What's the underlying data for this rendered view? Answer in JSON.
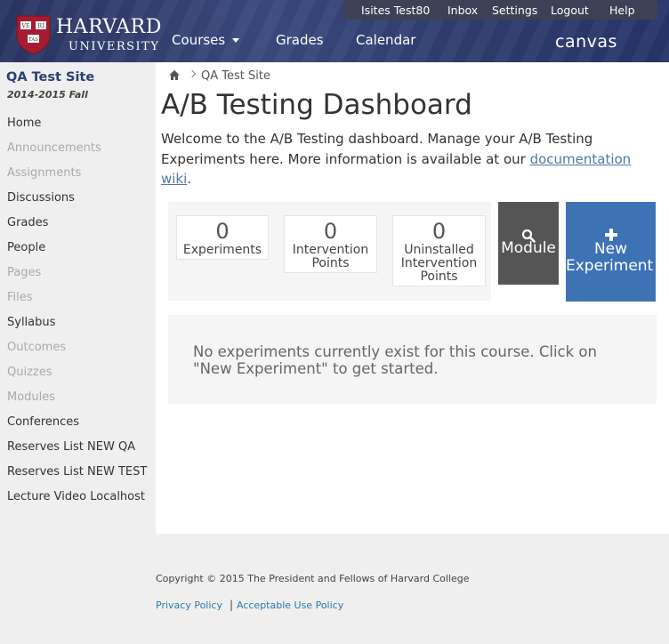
{
  "header": {
    "logo_line1": "HARVARD",
    "logo_line2": "UNIVERSITY",
    "shield_letters": [
      "VE",
      "RI",
      "TAS"
    ],
    "nav": {
      "courses": "Courses",
      "grades": "Grades",
      "calendar": "Calendar"
    },
    "brand": "canvas",
    "user_nav": [
      "Isites Test80",
      "Inbox",
      "Settings",
      "Logout",
      "Help"
    ]
  },
  "sidebar": {
    "course_title": "QA Test Site",
    "term": "2014-2015 Fall",
    "items": [
      {
        "label": "Home",
        "enabled": true
      },
      {
        "label": "Announcements",
        "enabled": false
      },
      {
        "label": "Assignments",
        "enabled": false
      },
      {
        "label": "Discussions",
        "enabled": true
      },
      {
        "label": "Grades",
        "enabled": true
      },
      {
        "label": "People",
        "enabled": true
      },
      {
        "label": "Pages",
        "enabled": false
      },
      {
        "label": "Files",
        "enabled": false
      },
      {
        "label": "Syllabus",
        "enabled": true
      },
      {
        "label": "Outcomes",
        "enabled": false
      },
      {
        "label": "Quizzes",
        "enabled": false
      },
      {
        "label": "Modules",
        "enabled": false
      },
      {
        "label": "Conferences",
        "enabled": true
      },
      {
        "label": "Reserves List NEW QA",
        "enabled": true
      },
      {
        "label": "Reserves List NEW TEST",
        "enabled": true
      },
      {
        "label": "Lecture Video Localhost",
        "enabled": true
      }
    ]
  },
  "breadcrumb": {
    "home_icon": "home-icon",
    "current": "QA Test Site"
  },
  "main": {
    "title": "A/B Testing Dashboard",
    "intro_text": "Welcome to the A/B Testing dashboard. Manage your A/B Testing Experiments here. More information is available at our ",
    "intro_link": "documentation wiki",
    "intro_end": ".",
    "stats": [
      {
        "value": "0",
        "label": "Experiments"
      },
      {
        "value": "0",
        "label": "Intervention Points"
      },
      {
        "value": "0",
        "label": "Uninstalled Intervention Points"
      }
    ],
    "module_button": "Module",
    "new_button": "New Experiment",
    "empty_message": "No experiments currently exist for this course. Click on \"New Experiment\" to get started."
  },
  "footer": {
    "copyright": "Copyright © 2015 The President and Fellows of Harvard College",
    "privacy": "Privacy Policy",
    "separator": "|",
    "acceptable_use": "Acceptable Use Policy"
  },
  "colors": {
    "header_bg": "#2e3d6e",
    "accent_blue": "#3d73b5",
    "module_gray": "#555555",
    "course_title": "#294073",
    "link": "#2a7ab0"
  }
}
